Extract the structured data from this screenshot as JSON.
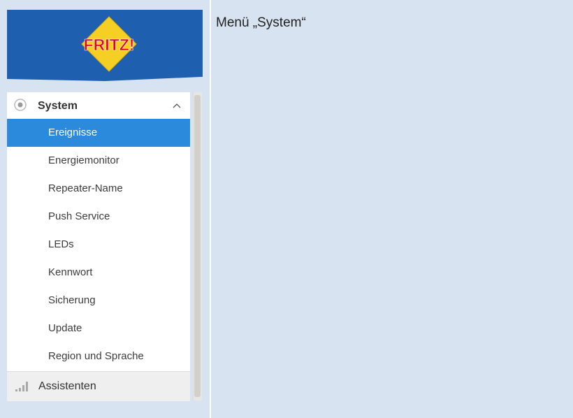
{
  "logo": {
    "text": "FRITZ!",
    "brand_blue": "#1f5fb0",
    "tile_yellow": "#f5cf23",
    "text_red": "#e2001a"
  },
  "sidebar": {
    "section_title": "System",
    "section_icon": "radio-dot-icon",
    "collapse_icon": "chevron-up-icon",
    "items": [
      {
        "label": "Ereignisse",
        "active": true
      },
      {
        "label": "Energiemonitor",
        "active": false
      },
      {
        "label": "Repeater-Name",
        "active": false
      },
      {
        "label": "Push Service",
        "active": false
      },
      {
        "label": "LEDs",
        "active": false
      },
      {
        "label": "Kennwort",
        "active": false
      },
      {
        "label": "Sicherung",
        "active": false
      },
      {
        "label": "Update",
        "active": false
      },
      {
        "label": "Region und Sprache",
        "active": false
      }
    ],
    "assistants": {
      "label": "Assistenten",
      "icon": "signal-bars-icon"
    },
    "active_color": "#2b8adb"
  },
  "content": {
    "title": "Menü „System“"
  }
}
